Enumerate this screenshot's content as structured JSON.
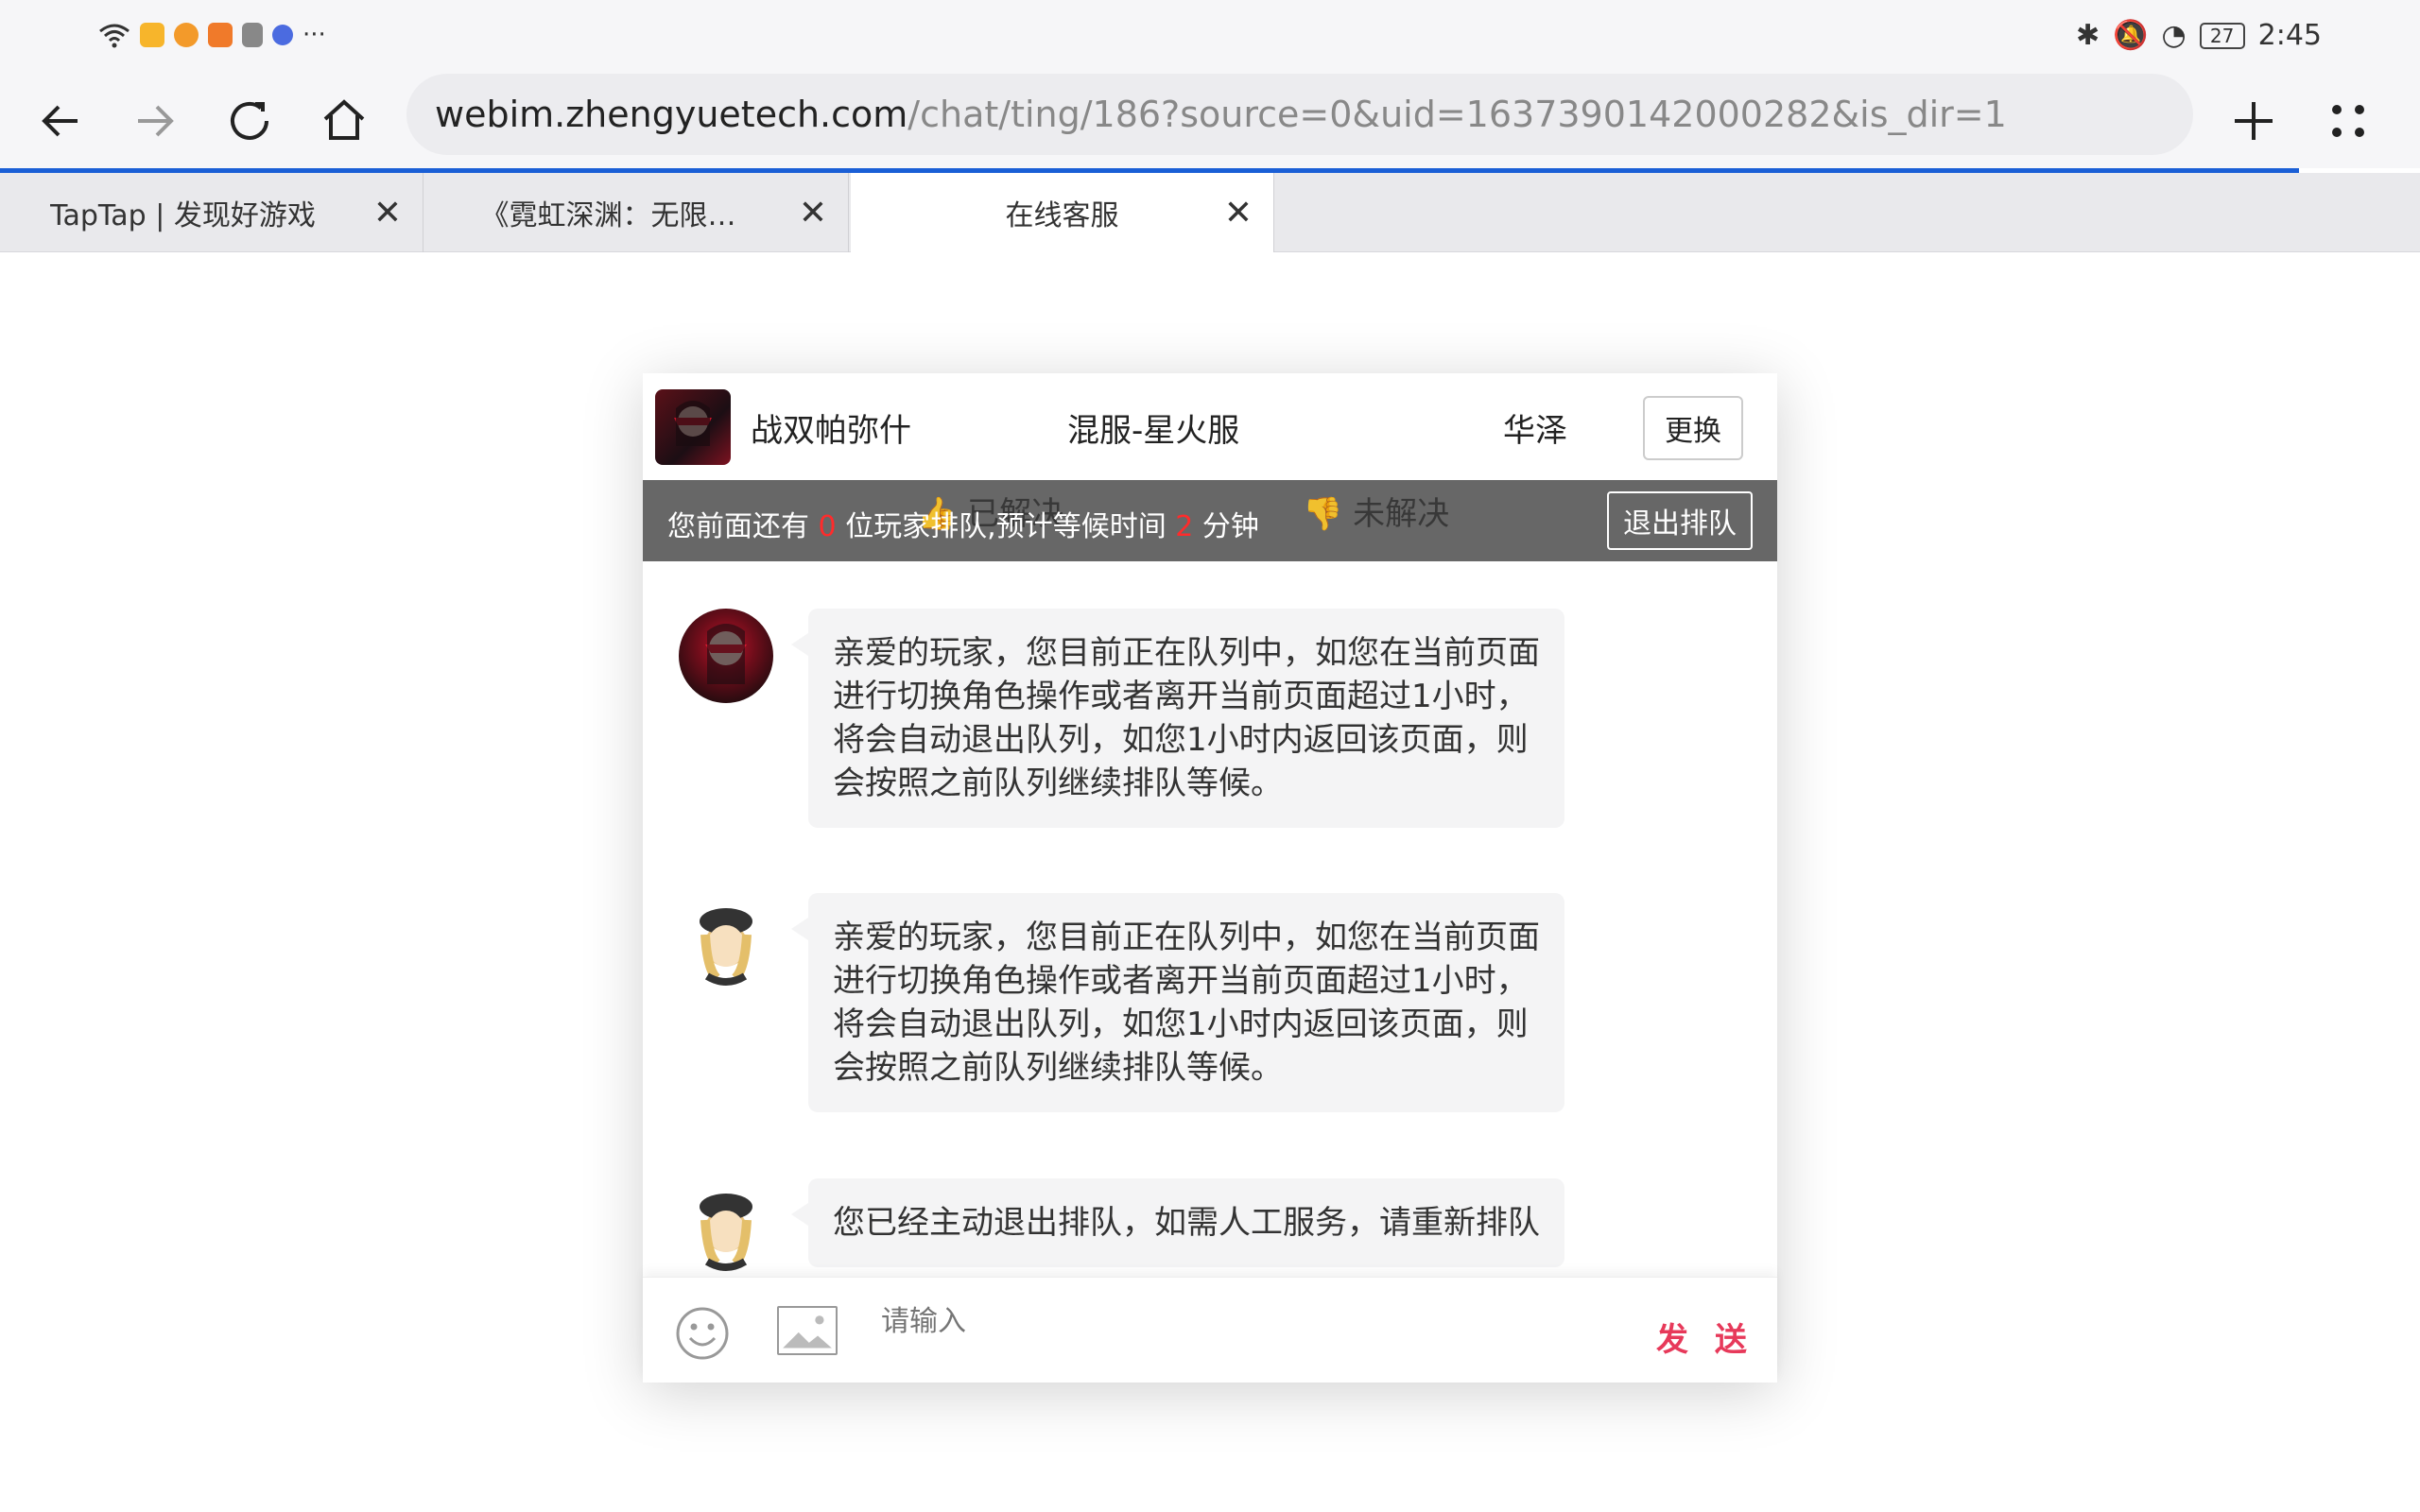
{
  "status_bar": {
    "time": "2:45",
    "battery": "27"
  },
  "toolbar": {
    "url_host": "webim.zhengyuetech.com",
    "url_path": "/chat/ting/186?source=0&uid=1637390142000282&is_dir=1"
  },
  "tabs": [
    {
      "label": "TapTap | 发现好游戏"
    },
    {
      "label": "《霓虹深渊：无限…"
    },
    {
      "label": "在线客服"
    }
  ],
  "header": {
    "game_name": "战双帕弥什",
    "server": "混服-星火服",
    "role": "华泽",
    "change_label": "更换"
  },
  "queue": {
    "prefix": "您前面还有",
    "count": "0",
    "middle": "位玩家排队,预计等候时间",
    "wait": "2",
    "suffix": "分钟",
    "ghost_resolved": "已解决",
    "ghost_unresolved": "未解决",
    "exit_label": "退出排队"
  },
  "messages": [
    {
      "text": "亲爱的玩家，您目前正在队列中，如您在当前页面进行切换角色操作或者离开当前页面超过1小时，将会自动退出队列，如您1小时内返回该页面，则会按照之前队列继续排队等候。"
    },
    {
      "text": "亲爱的玩家，您目前正在队列中，如您在当前页面进行切换角色操作或者离开当前页面超过1小时，将会自动退出队列，如您1小时内返回该页面，则会按照之前队列继续排队等候。"
    },
    {
      "text": "您已经主动退出排队，如需人工服务，请重新排队"
    }
  ],
  "input": {
    "placeholder": "请输入",
    "send_label": "发 送"
  },
  "colors": {
    "accent": "#1a5fd6",
    "send": "#e7395a",
    "queue_number": "#ff2b2b"
  }
}
